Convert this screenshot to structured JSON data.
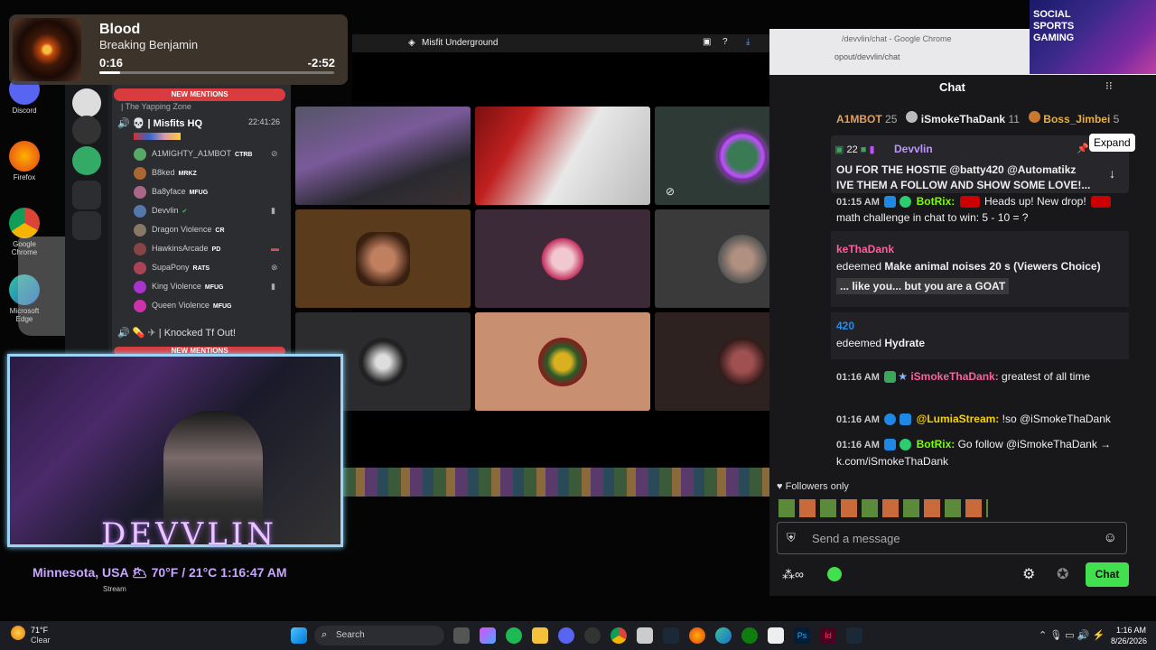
{
  "desktop": {
    "icons": [
      {
        "label": "Discord",
        "color": "#5865f2"
      },
      {
        "label": "Firefox",
        "color": "#ff7139"
      },
      {
        "label": "Google Chrome",
        "color": "#4285f4"
      },
      {
        "label": "Microsoft Edge",
        "color": "#1e88c7"
      }
    ]
  },
  "media": {
    "title": "Blood",
    "artist": "Breaking Benjamin",
    "current": "0:16",
    "remaining": "-2:52",
    "progress": 0.09
  },
  "discord": {
    "banner_top": "NEW MENTIONS",
    "banner_bottom": "NEW MENTIONS",
    "category": "| The Yapping Zone",
    "channel": "💀 | Misfits HQ",
    "channel_time": "22:41:26",
    "users": [
      {
        "name": "A1MIGHTY_A1MBOT",
        "tag": "CTRB",
        "color": "#5a6"
      },
      {
        "name": "B8ked",
        "tag": "MRKZ",
        "color": "#a63"
      },
      {
        "name": "Ba8yface",
        "tag": "MFUG",
        "color": "#a68"
      },
      {
        "name": "Devvlin",
        "tag": "",
        "color": "#57a"
      },
      {
        "name": "Dragon Violence",
        "tag": "CR",
        "color": "#876"
      },
      {
        "name": "HawkinsArcade",
        "tag": "PD",
        "color": "#844"
      },
      {
        "name": "SupaPony",
        "tag": "RATS",
        "color": "#a45"
      },
      {
        "name": "King Violence",
        "tag": "MFUG",
        "color": "#a3c"
      },
      {
        "name": "Queen Violence",
        "tag": "MFUG",
        "color": "#c3a"
      }
    ],
    "channel2": "| Knocked Tf Out!"
  },
  "meeting": {
    "title": "Misfit Underground"
  },
  "chat": {
    "browser_title": "/devvlin/chat - Google Chrome",
    "url": "opout/devvlin/chat",
    "header": "Chat",
    "leaders": [
      {
        "name": "A1MBOT",
        "value": "25"
      },
      {
        "name": "iSmokeThaDank",
        "value": "11"
      },
      {
        "name": "Boss_Jimbei",
        "value": "5"
      }
    ],
    "pinned": {
      "user": "Devvlin",
      "count": "22",
      "line1": "OU FOR THE HOSTIE @batty420 @Automatikz",
      "line2": "IVE THEM A FOLLOW AND SHOW SOME LOVE!..."
    },
    "expand": "Expand",
    "messages": [
      {
        "time": "01:15 AM",
        "user": "BotRix:",
        "text": "Heads up! New drop!",
        "text2": "math challenge in chat to win: 5 - 10 = ?"
      },
      {
        "user": "keThaDank",
        "text": "edeemed ",
        "bold": "Make animal noises 20 s (Viewers Choice)",
        "quote": "... like you... but you are a GOAT"
      },
      {
        "user": "420",
        "text": "edeemed ",
        "bold": "Hydrate"
      },
      {
        "time": "01:16 AM",
        "user": "iSmokeThaDank:",
        "text": "greatest of all time"
      },
      {
        "time": "01:16 AM",
        "user": "@LumiaStream:",
        "text": "!so @iSmokeThaDank"
      },
      {
        "time": "01:16 AM",
        "user": "BotRix:",
        "text": "Go follow @iSmokeThaDank →",
        "text2": "k.com/iSmokeThaDank"
      }
    ],
    "followers": "Followers only",
    "placeholder": "Send a message",
    "chat_button": "Chat"
  },
  "stream": {
    "name": "DEVVLIN",
    "weather": "Minnesota, USA 🌥 70°F / 21°C 1:16:47 AM",
    "label": "Stream"
  },
  "taskbar": {
    "weather_temp": "71°F",
    "weather_desc": "Clear",
    "search": "Search",
    "time": "1:16 AM",
    "date": "8/26/2026"
  }
}
